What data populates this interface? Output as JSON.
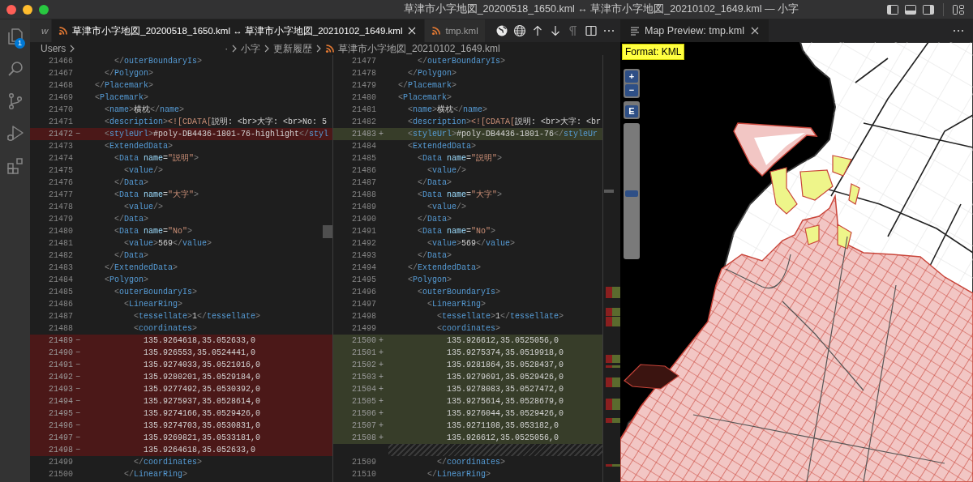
{
  "window": {
    "title": "草津市小字地図_20200518_1650.kml ↔ 草津市小字地図_20210102_1649.kml — 小字"
  },
  "activity_bar": {
    "items": [
      {
        "kind": "explorer",
        "badge": "1"
      },
      {
        "kind": "search"
      },
      {
        "kind": "source-control"
      },
      {
        "kind": "run-debug"
      },
      {
        "kind": "extensions"
      }
    ]
  },
  "tabs": [
    {
      "label": "w",
      "selected": false,
      "kind": "partial"
    },
    {
      "label": "草津市小字地図_20200518_1650.kml ↔ 草津市小字地図_20210102_1649.kml",
      "selected": true,
      "kind": "file"
    },
    {
      "label": "tmp.kml",
      "selected": false,
      "kind": "file"
    }
  ],
  "editor_actions": [
    {
      "kind": "globe-filled",
      "disabled": false
    },
    {
      "kind": "globe",
      "disabled": false
    },
    {
      "kind": "arrow-up",
      "disabled": false
    },
    {
      "kind": "arrow-down",
      "disabled": false
    },
    {
      "kind": "pilcrow",
      "disabled": true
    },
    {
      "kind": "split",
      "disabled": false
    },
    {
      "kind": "more",
      "disabled": false
    }
  ],
  "preview_tab": {
    "label": "Map Preview: tmp.kml",
    "selected": true
  },
  "breadcrumb": [
    "Users",
    "·",
    "小字",
    "更新履歴",
    "草津市小字地図_20210102_1649.kml"
  ],
  "diff": {
    "left": {
      "lines": [
        {
          "number": "21466",
          "kind": "context",
          "text": "      </outerBoundaryIs>"
        },
        {
          "number": "21467",
          "kind": "context",
          "text": "    </Polygon>"
        },
        {
          "number": "21468",
          "kind": "context",
          "text": "  </Placemark>"
        },
        {
          "number": "21469",
          "kind": "context",
          "text": "  <Placemark>"
        },
        {
          "number": "21470",
          "kind": "context",
          "text": "    <name>横枕</name>"
        },
        {
          "number": "21471",
          "kind": "context",
          "text": "    <description><![CDATA[説明: <br>大字: <br>No: 5"
        },
        {
          "number": "21472",
          "marker": "−",
          "kind": "removed",
          "text": "    <styleUrl>#poly-DB4436-1801-76-highlight</styl"
        },
        {
          "number": "21473",
          "kind": "context",
          "text": "    <ExtendedData>"
        },
        {
          "number": "21474",
          "kind": "context",
          "text": "      <Data name=\"説明\">"
        },
        {
          "number": "21475",
          "kind": "context",
          "text": "        <value/>"
        },
        {
          "number": "21476",
          "kind": "context",
          "text": "      </Data>"
        },
        {
          "number": "21477",
          "kind": "context",
          "text": "      <Data name=\"大字\">"
        },
        {
          "number": "21478",
          "kind": "context",
          "text": "        <value/>"
        },
        {
          "number": "21479",
          "kind": "context",
          "text": "      </Data>"
        },
        {
          "number": "21480",
          "kind": "context",
          "text": "      <Data name=\"No\">"
        },
        {
          "number": "21481",
          "kind": "context",
          "text": "        <value>569</value>"
        },
        {
          "number": "21482",
          "kind": "context",
          "text": "      </Data>"
        },
        {
          "number": "21483",
          "kind": "context",
          "text": "    </ExtendedData>"
        },
        {
          "number": "21484",
          "kind": "context",
          "text": "    <Polygon>"
        },
        {
          "number": "21485",
          "kind": "context",
          "text": "      <outerBoundaryIs>"
        },
        {
          "number": "21486",
          "kind": "context",
          "text": "        <LinearRing>"
        },
        {
          "number": "21487",
          "kind": "context",
          "text": "          <tessellate>1</tessellate>"
        },
        {
          "number": "21488",
          "kind": "context",
          "text": "          <coordinates>"
        },
        {
          "number": "21489",
          "marker": "−",
          "kind": "removed",
          "text": "            135.9264618,35.052633,0"
        },
        {
          "number": "21490",
          "marker": "−",
          "kind": "removed",
          "text": "            135.926553,35.0524441,0"
        },
        {
          "number": "21491",
          "marker": "−",
          "kind": "removed",
          "text": "            135.9274033,35.0521016,0"
        },
        {
          "number": "21492",
          "marker": "−",
          "kind": "removed",
          "text": "            135.9280201,35.0529184,0"
        },
        {
          "number": "21493",
          "marker": "−",
          "kind": "removed",
          "text": "            135.9277492,35.0530392,0"
        },
        {
          "number": "21494",
          "marker": "−",
          "kind": "removed",
          "text": "            135.9275937,35.0528614,0"
        },
        {
          "number": "21495",
          "marker": "−",
          "kind": "removed",
          "text": "            135.9274166,35.0529426,0"
        },
        {
          "number": "21496",
          "marker": "−",
          "kind": "removed",
          "text": "            135.9274703,35.0530831,0"
        },
        {
          "number": "21497",
          "marker": "−",
          "kind": "removed",
          "text": "            135.9269821,35.0533181,0"
        },
        {
          "number": "21498",
          "marker": "−",
          "kind": "removed",
          "text": "            135.9264618,35.052633,0"
        },
        {
          "number": "21499",
          "kind": "context",
          "text": "          </coordinates>"
        },
        {
          "number": "21500",
          "kind": "context",
          "text": "        </LinearRing>"
        }
      ]
    },
    "right": {
      "lines": [
        {
          "number": "21477",
          "kind": "context",
          "text": "      </outerBoundaryIs>"
        },
        {
          "number": "21478",
          "kind": "context",
          "text": "    </Polygon>"
        },
        {
          "number": "21479",
          "kind": "context",
          "text": "  </Placemark>"
        },
        {
          "number": "21480",
          "kind": "context",
          "text": "  <Placemark>"
        },
        {
          "number": "21481",
          "kind": "context",
          "text": "    <name>横枕</name>"
        },
        {
          "number": "21482",
          "kind": "context",
          "text": "    <description><![CDATA[説明: <br>大字: <br"
        },
        {
          "number": "21483",
          "marker": "+",
          "kind": "added",
          "text": "    <styleUrl>#poly-DB4436-1801-76</styleUr"
        },
        {
          "number": "21484",
          "kind": "context",
          "text": "    <ExtendedData>"
        },
        {
          "number": "21485",
          "kind": "context",
          "text": "      <Data name=\"説明\">"
        },
        {
          "number": "21486",
          "kind": "context",
          "text": "        <value/>"
        },
        {
          "number": "21487",
          "kind": "context",
          "text": "      </Data>"
        },
        {
          "number": "21488",
          "kind": "context",
          "text": "      <Data name=\"大字\">"
        },
        {
          "number": "21489",
          "kind": "context",
          "text": "        <value/>"
        },
        {
          "number": "21490",
          "kind": "context",
          "text": "      </Data>"
        },
        {
          "number": "21491",
          "kind": "context",
          "text": "      <Data name=\"No\">"
        },
        {
          "number": "21492",
          "kind": "context",
          "text": "        <value>569</value>"
        },
        {
          "number": "21493",
          "kind": "context",
          "text": "      </Data>"
        },
        {
          "number": "21494",
          "kind": "context",
          "text": "    </ExtendedData>"
        },
        {
          "number": "21495",
          "kind": "context",
          "text": "    <Polygon>"
        },
        {
          "number": "21496",
          "kind": "context",
          "text": "      <outerBoundaryIs>"
        },
        {
          "number": "21497",
          "kind": "context",
          "text": "        <LinearRing>"
        },
        {
          "number": "21498",
          "kind": "context",
          "text": "          <tessellate>1</tessellate>"
        },
        {
          "number": "21499",
          "kind": "context",
          "text": "          <coordinates>"
        },
        {
          "number": "21500",
          "marker": "+",
          "kind": "added",
          "text": "            135.926612,35.0525056,0"
        },
        {
          "number": "21501",
          "marker": "+",
          "kind": "added",
          "text": "            135.9275374,35.0519918,0"
        },
        {
          "number": "21502",
          "marker": "+",
          "kind": "added",
          "text": "            135.9281864,35.0528437,0"
        },
        {
          "number": "21503",
          "marker": "+",
          "kind": "added",
          "text": "            135.9279691,35.0529426,0"
        },
        {
          "number": "21504",
          "marker": "+",
          "kind": "added",
          "text": "            135.9278083,35.0527472,0"
        },
        {
          "number": "21505",
          "marker": "+",
          "kind": "added",
          "text": "            135.9275614,35.0528679,0"
        },
        {
          "number": "21506",
          "marker": "+",
          "kind": "added",
          "text": "            135.9276044,35.0529426,0"
        },
        {
          "number": "21507",
          "marker": "+",
          "kind": "added",
          "text": "            135.9271108,35.053182,0"
        },
        {
          "number": "21508",
          "marker": "+",
          "kind": "added",
          "text": "            135.926612,35.0525056,0"
        },
        {
          "kind": "filler"
        },
        {
          "number": "21509",
          "kind": "context",
          "text": "          </coordinates>"
        },
        {
          "number": "21510",
          "kind": "context",
          "text": "        </LinearRing>"
        }
      ]
    }
  },
  "map": {
    "format_label": "Format: KML",
    "zoom_in": "+",
    "zoom_out": "−",
    "extent": "E",
    "zoom_slider": {
      "level": 0.48
    }
  }
}
